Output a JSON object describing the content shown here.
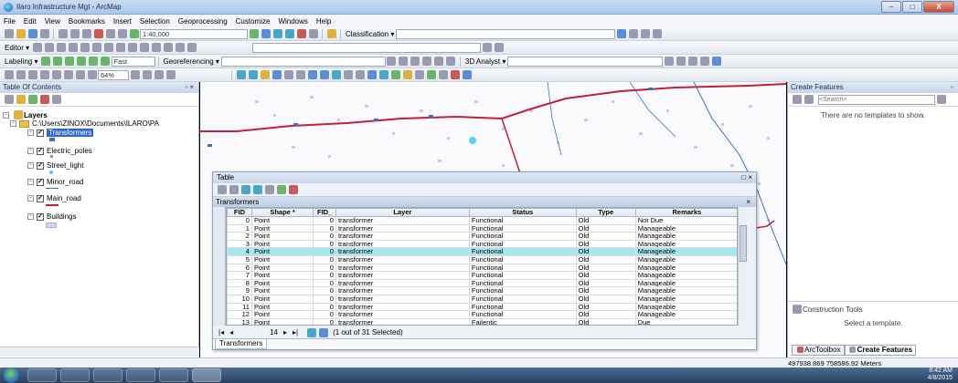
{
  "window": {
    "title": "Ilaro Infrastructure Mgt - ArcMap",
    "btn_min": "–",
    "btn_max": "□",
    "btn_close": "X"
  },
  "menu": [
    "File",
    "Edit",
    "View",
    "Bookmarks",
    "Insert",
    "Selection",
    "Geoprocessing",
    "Customize",
    "Windows",
    "Help"
  ],
  "toolbar1": {
    "scale": "1:40,000",
    "classification": "Classification ▾"
  },
  "toolbar2": {
    "editor": "Editor ▾"
  },
  "toolbar3": {
    "labeling": "Labeling ▾",
    "fast": "Fast",
    "georeferencing": "Georeferencing ▾",
    "analyst3d": "3D Analyst ▾"
  },
  "toolbar4": {
    "zoom": "64%"
  },
  "toc": {
    "title": "Table Of Contents",
    "pin": "▫ ×",
    "layers": "Layers",
    "path": "C:\\Users\\ZINOX\\Documents\\ILARO\\PA",
    "items": [
      "Transformers",
      "Electric_poles",
      "Street_light",
      "Minor_road",
      "Main_road",
      "Buildings"
    ]
  },
  "right_pane": {
    "title": "Create Features",
    "pin": "▫",
    "search_placeholder": "<Search>",
    "empty_msg": "There are no templates to show.",
    "construction": "Construction Tools",
    "select_template": "Select a template.",
    "tab_arctoolbox": "ArcToolbox",
    "tab_create": "Create Features"
  },
  "table": {
    "win_title": "Table",
    "win_btns": "□ ×",
    "tab_title": "Transformers",
    "tab_close": "×",
    "columns": [
      "FID",
      "Shape *",
      "FID_",
      "Layer",
      "Status",
      "Type",
      "Remarks"
    ],
    "rows": [
      [
        "0",
        "Point",
        "0",
        "transformer",
        "Functional",
        "Old",
        "Not Due"
      ],
      [
        "1",
        "Point",
        "0",
        "transformer",
        "Functional",
        "Old",
        "Manageable"
      ],
      [
        "2",
        "Point",
        "0",
        "transformer",
        "Functional",
        "Old",
        "Manageable"
      ],
      [
        "3",
        "Point",
        "0",
        "transformer",
        "Functional",
        "Old",
        "Manageable"
      ],
      [
        "4",
        "Point",
        "0",
        "transformer",
        "Functional",
        "Old",
        "Manageable"
      ],
      [
        "5",
        "Point",
        "0",
        "transformer",
        "Functional",
        "Old",
        "Manageable"
      ],
      [
        "6",
        "Point",
        "0",
        "transformer",
        "Functional",
        "Old",
        "Manageable"
      ],
      [
        "7",
        "Point",
        "0",
        "transformer",
        "Functional",
        "Old",
        "Manageable"
      ],
      [
        "8",
        "Point",
        "0",
        "transformer",
        "Functional",
        "Old",
        "Manageable"
      ],
      [
        "9",
        "Point",
        "0",
        "transformer",
        "Functional",
        "Old",
        "Manageable"
      ],
      [
        "10",
        "Point",
        "0",
        "transformer",
        "Functional",
        "Old",
        "Manageable"
      ],
      [
        "11",
        "Point",
        "0",
        "transformer",
        "Functional",
        "Old",
        "Manageable"
      ],
      [
        "12",
        "Point",
        "0",
        "transformer",
        "Functional",
        "Old",
        "Manageable"
      ],
      [
        "13",
        "Point",
        "0",
        "transformer",
        "Failentic",
        "Old",
        "Due"
      ]
    ],
    "selected_row": 4,
    "record": "14",
    "selection_text": "(1 out of 31 Selected)",
    "bottom_tab": "Transformers"
  },
  "status": {
    "coords": "497938.869  758586.92 Meters"
  },
  "taskbar": {
    "time": "8:42 AM",
    "date": "4/8/2015"
  },
  "colors": {
    "accent": "#1e5aa8",
    "road_main": "#c0203a",
    "road_minor": "#3a6fc4",
    "selection": "#a7e7ef"
  }
}
